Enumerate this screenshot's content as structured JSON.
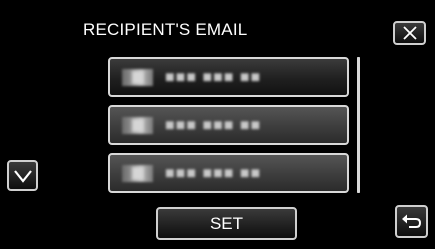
{
  "header": {
    "title": "RECIPIENT'S EMAIL"
  },
  "list": {
    "items": [
      {
        "text": "■■■ ■■■ ■■",
        "selected": true
      },
      {
        "text": "■■■ ■■■ ■■",
        "selected": false
      },
      {
        "text": "■■■ ■■■ ■■",
        "selected": false
      }
    ]
  },
  "actions": {
    "set_label": "SET"
  },
  "icons": {
    "close": "close-icon",
    "scroll_down": "chevron-down-icon",
    "back": "return-arrow-icon"
  }
}
